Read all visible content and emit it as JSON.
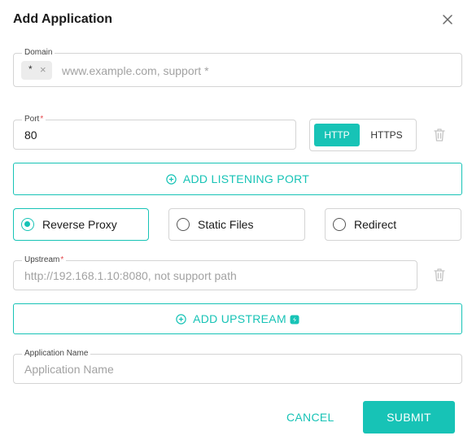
{
  "dialog": {
    "title": "Add Application"
  },
  "domain": {
    "label": "Domain",
    "chips": [
      {
        "text": "*"
      }
    ],
    "placeholder": "www.example.com, support *"
  },
  "port": {
    "label": "Port",
    "required_mark": "*",
    "value": "80",
    "protocols": [
      "HTTP",
      "HTTPS"
    ],
    "selected_protocol": "HTTP"
  },
  "add_listening_port": {
    "label": "ADD LISTENING PORT"
  },
  "mode": {
    "options": [
      "Reverse Proxy",
      "Static Files",
      "Redirect"
    ],
    "selected": "Reverse Proxy"
  },
  "upstream": {
    "label": "Upstream",
    "required_mark": "*",
    "placeholder": "http://192.168.1.10:8080, not support path"
  },
  "add_upstream": {
    "label": "ADD UPSTREAM"
  },
  "app_name": {
    "label": "Application Name",
    "placeholder": "Application Name"
  },
  "actions": {
    "cancel": "CANCEL",
    "submit": "SUBMIT"
  },
  "colors": {
    "accent": "#17c3b6",
    "required": "#e5484d"
  },
  "icons": {
    "close": "close-icon",
    "trash": "trash-icon",
    "add": "plus-circle-icon",
    "hint": "hint-icon"
  }
}
